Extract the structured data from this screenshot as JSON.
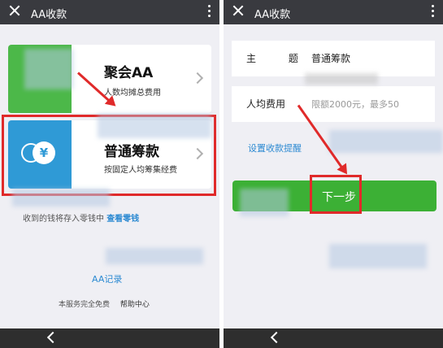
{
  "left_screen": {
    "title": "AA收款",
    "cards": [
      {
        "name": "聚会AA",
        "description": "人数均摊总费用"
      },
      {
        "name": "普通筹款",
        "description": "按固定人均筹集经费",
        "icon_symbol": "¥"
      }
    ],
    "hint_text": "收到的钱将存入零钱中",
    "hint_link": "查看零钱",
    "aa_record": "AA记录",
    "free_note": "本服务完全免费",
    "help_center": "帮助中心"
  },
  "right_screen": {
    "title": "AA收款",
    "subject_label": "主 题",
    "subject_value": "普通筹款",
    "per_person_label": "人均费用",
    "per_person_placeholder": "限额2000元，最多50",
    "remind_link": "设置收款提醒",
    "next_button": "下一步"
  },
  "colors": {
    "topbar": "#393a3f",
    "green_card": "#4cb849",
    "blue_card": "#2f9ad6",
    "highlight": "#e02a2a",
    "link": "#2c8ad2",
    "primary_button": "#3cb035"
  }
}
